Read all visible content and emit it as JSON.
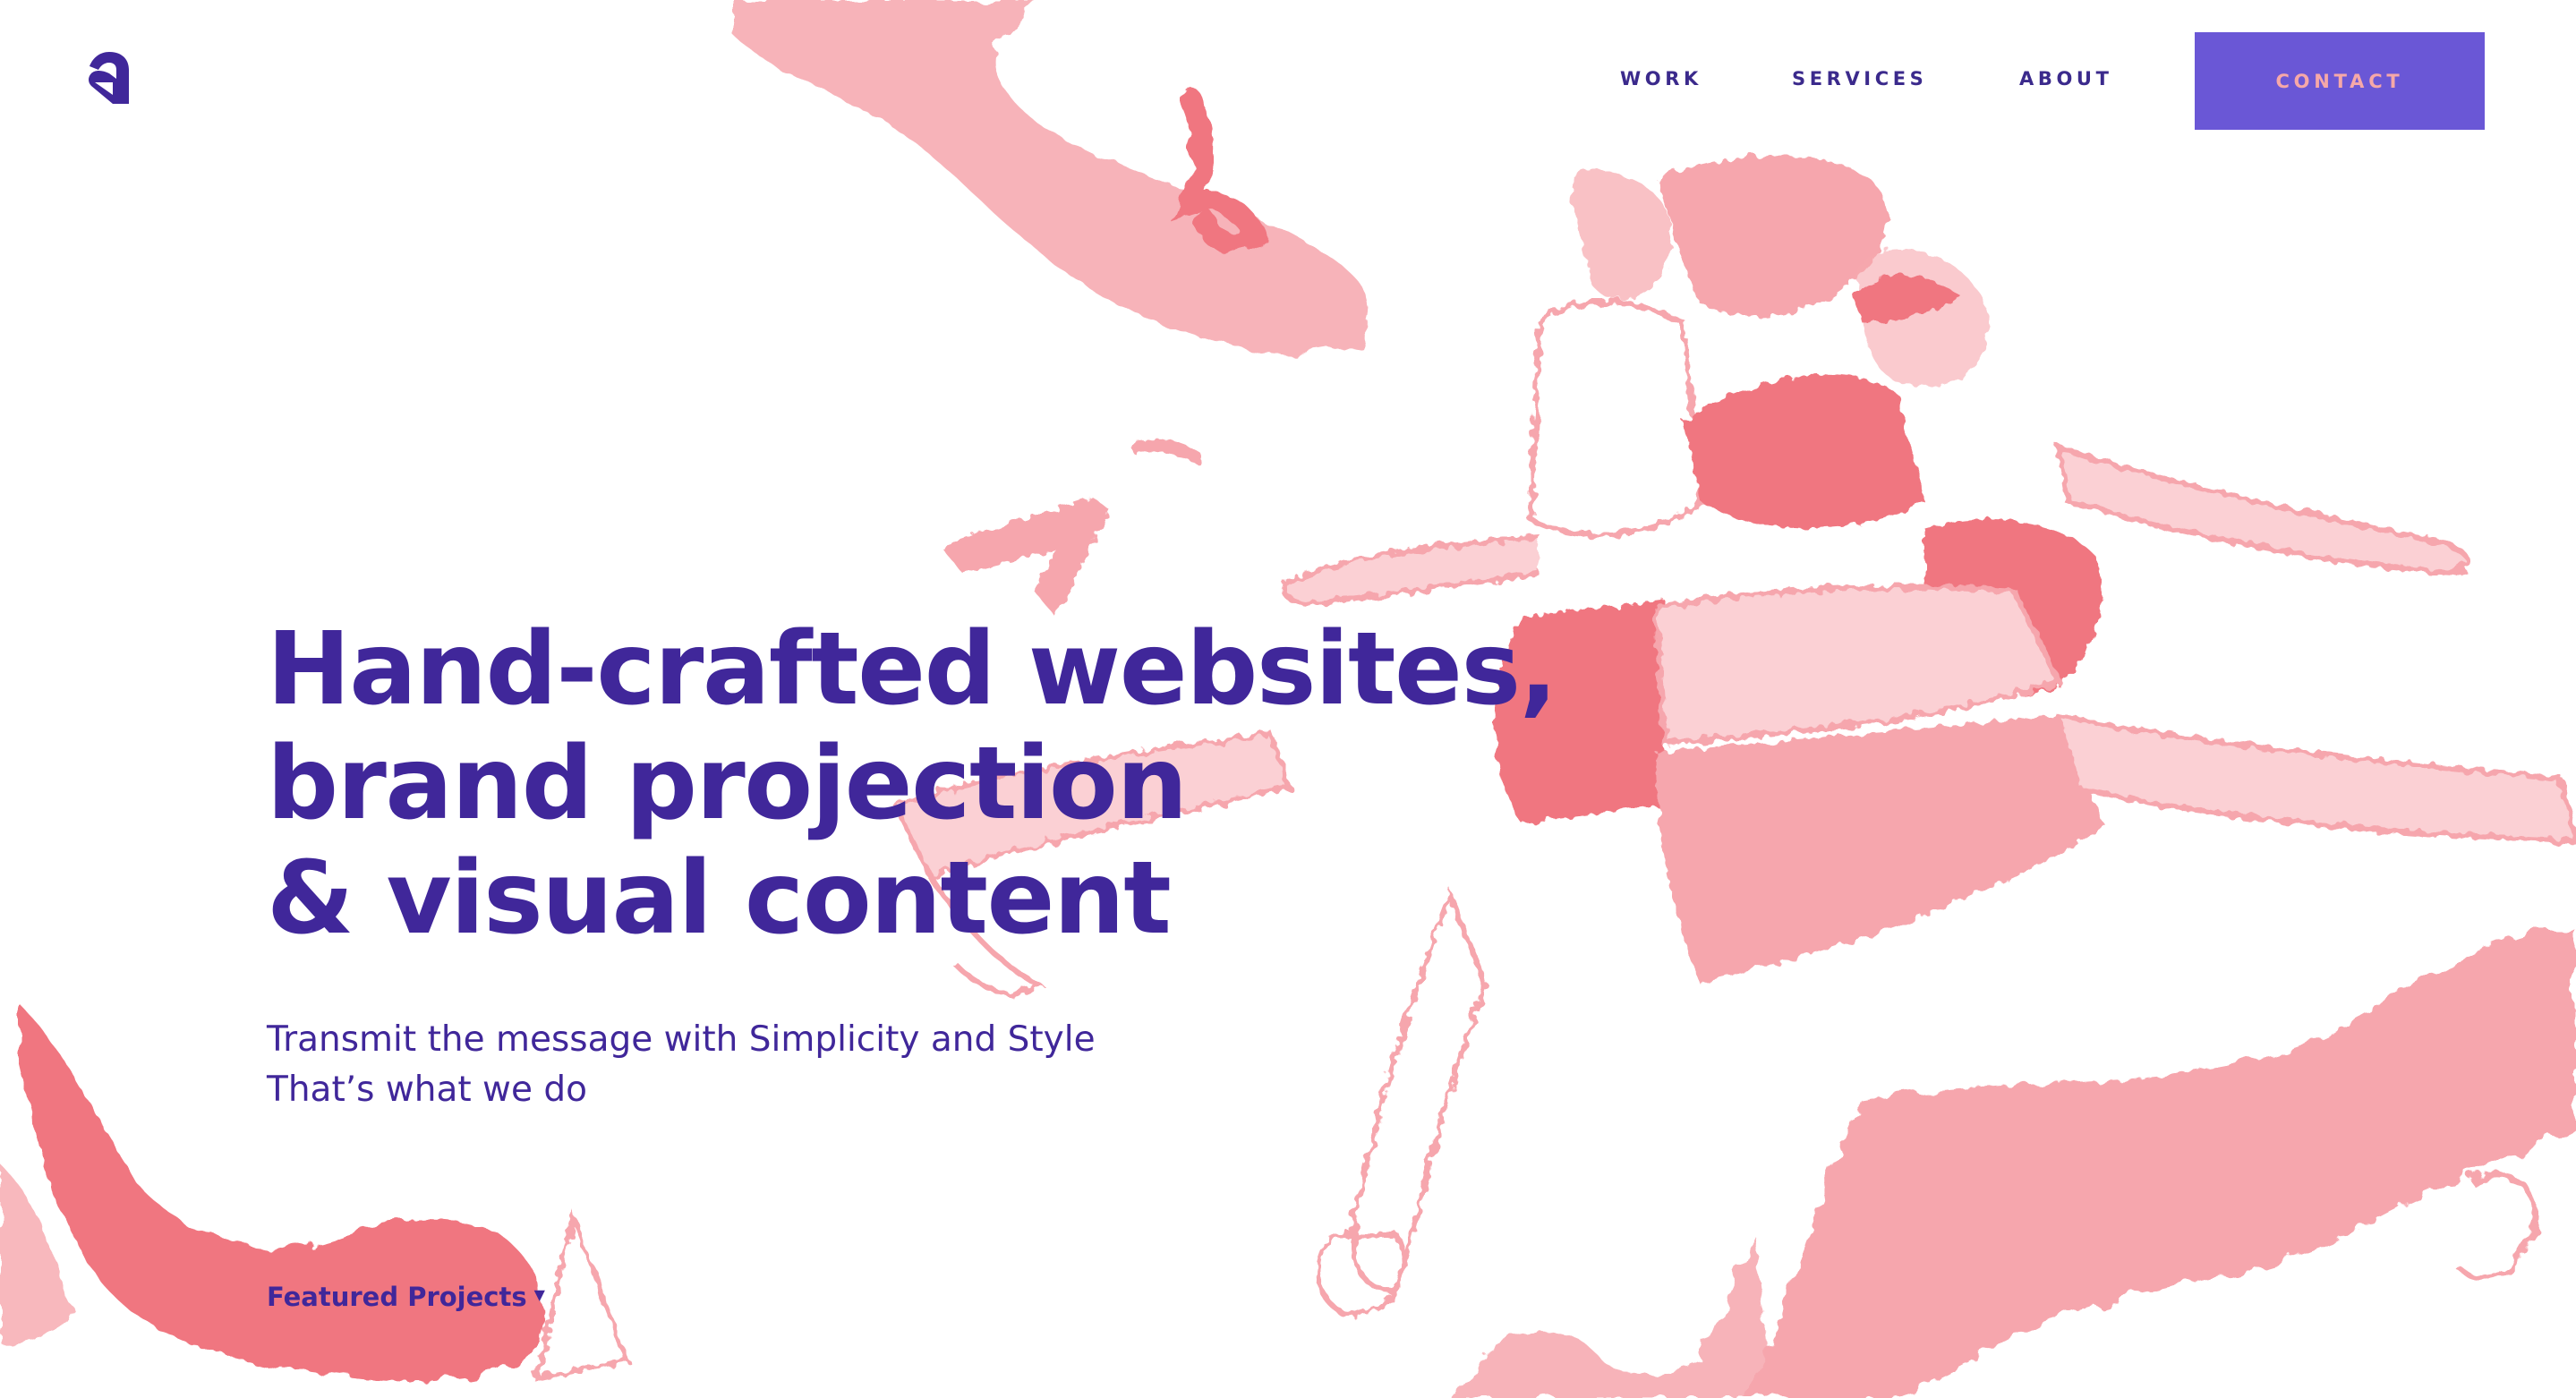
{
  "header": {
    "logo_icon": "studio-monogram-logo",
    "nav": [
      {
        "label": "WORK"
      },
      {
        "label": "SERVICES"
      },
      {
        "label": "ABOUT"
      }
    ],
    "contact_label": "CONTACT"
  },
  "hero": {
    "title_lines": [
      "Hand-crafted websites,",
      "brand projection",
      "& visual content"
    ],
    "subtitle_lines": [
      "Transmit the message with Simplicity and Style",
      "That’s what we do"
    ],
    "featured_label": "Featured Projects",
    "featured_icon": "caret-down-icon"
  },
  "colors": {
    "brand_purple": "#40279a",
    "button_bg": "#6a57d6",
    "button_text": "#f6a8a8",
    "pink_light": "#f6a6ad",
    "pink_strong": "#f07680"
  }
}
